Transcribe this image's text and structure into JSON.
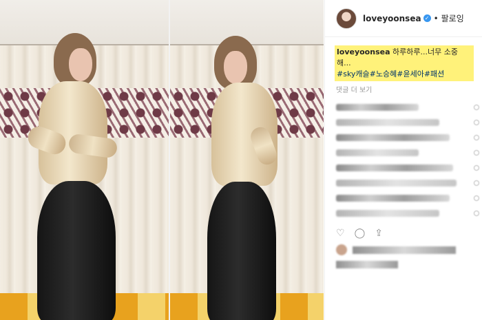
{
  "post": {
    "username": "loveyoonsea",
    "verified_mark": "✓",
    "separator": "•",
    "follow_label": "팔로잉",
    "caption_user": "loveyoonsea",
    "caption_text": " 하루하루...너무 소중해...",
    "caption_tags": "#sky캐슬#노승혜#윤세아#패션",
    "view_more_label": "댓글 더 보기"
  },
  "actions": {
    "like_icon": "♡",
    "comment_icon": "◯",
    "share_icon": "⇪"
  },
  "icons": {
    "avatar": "avatar",
    "verified": "verified-badge-icon",
    "like": "heart-icon",
    "comment": "comment-icon",
    "share": "share-icon"
  },
  "colors": {
    "highlight": "#fff27a",
    "link": "#003569",
    "verified": "#3897f0"
  }
}
